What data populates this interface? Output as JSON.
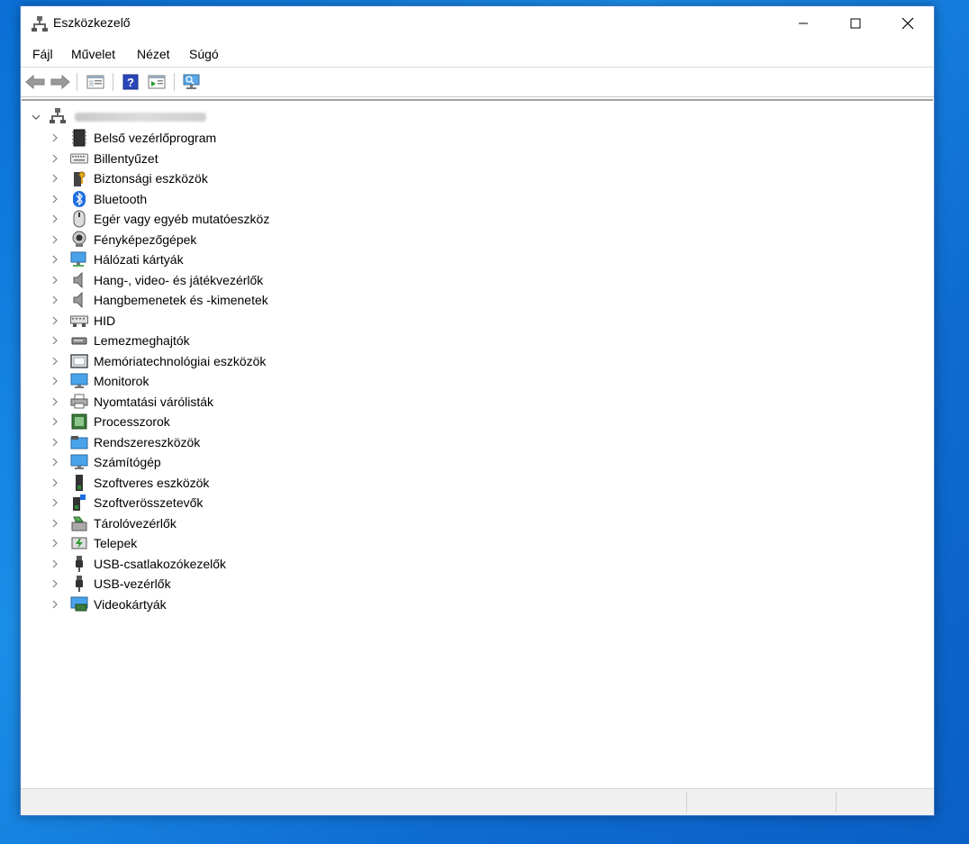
{
  "window": {
    "title": "Eszközkezelő"
  },
  "menu": [
    "Fájl",
    "Művelet",
    "Nézet",
    "Súgó"
  ],
  "toolbar": [
    "back-arrow-icon",
    "forward-arrow-icon",
    "properties-pane-icon",
    "help-icon",
    "action-pane-icon",
    "scan-hardware-icon"
  ],
  "tree": {
    "root_label": "",
    "categories": [
      {
        "label": "Belső vezérlőprogram",
        "icon": "firmware-icon"
      },
      {
        "label": "Billentyűzet",
        "icon": "keyboard-icon"
      },
      {
        "label": "Biztonsági eszközök",
        "icon": "security-device-icon"
      },
      {
        "label": "Bluetooth",
        "icon": "bluetooth-icon"
      },
      {
        "label": "Egér vagy egyéb mutatóeszköz",
        "icon": "mouse-icon"
      },
      {
        "label": "Fényképezőgépek",
        "icon": "camera-icon"
      },
      {
        "label": "Hálózati kártyák",
        "icon": "network-adapter-icon"
      },
      {
        "label": "Hang-, video- és játékvezérlők",
        "icon": "speaker-icon"
      },
      {
        "label": "Hangbemenetek és -kimenetek",
        "icon": "speaker-icon"
      },
      {
        "label": "HID",
        "icon": "hid-icon"
      },
      {
        "label": "Lemezmeghajtók",
        "icon": "disk-drive-icon"
      },
      {
        "label": "Memóriatechnológiai eszközök",
        "icon": "memory-tech-icon"
      },
      {
        "label": "Monitorok",
        "icon": "monitor-icon"
      },
      {
        "label": "Nyomtatási várólisták",
        "icon": "printer-icon"
      },
      {
        "label": "Processzorok",
        "icon": "processor-icon"
      },
      {
        "label": "Rendszereszközök",
        "icon": "system-devices-icon"
      },
      {
        "label": "Számítógép",
        "icon": "computer-icon"
      },
      {
        "label": "Szoftveres eszközök",
        "icon": "software-device-icon"
      },
      {
        "label": "Szoftverösszetevők",
        "icon": "software-component-icon"
      },
      {
        "label": "Tárolóvezérlők",
        "icon": "storage-controller-icon"
      },
      {
        "label": "Telepek",
        "icon": "battery-icon"
      },
      {
        "label": "USB-csatlakozókezelők",
        "icon": "usb-icon"
      },
      {
        "label": "USB-vezérlők",
        "icon": "usb-icon"
      },
      {
        "label": "Videokártyák",
        "icon": "display-adapter-icon"
      }
    ]
  },
  "colors": {
    "desktop": "#0e7ad8",
    "accent": "#1e6fd0",
    "border": "#3c78c8"
  }
}
